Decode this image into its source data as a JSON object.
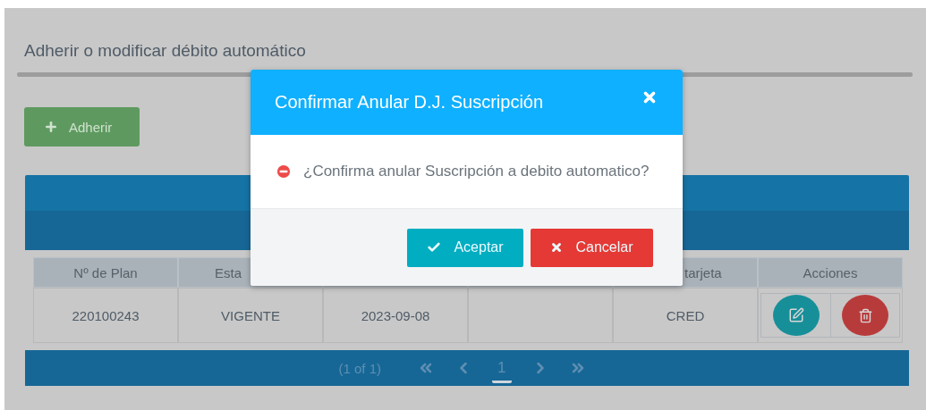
{
  "page": {
    "title": "Adherir o modificar débito automático"
  },
  "add_button": {
    "label": "Adherir"
  },
  "table": {
    "columns": [
      {
        "kind": "text",
        "label": "Nº de Plan"
      },
      {
        "kind": "text",
        "label": "Esta"
      },
      {
        "kind": "covered"
      },
      {
        "kind": "covered"
      },
      {
        "kind": "text",
        "label": "tarjeta"
      },
      {
        "kind": "text",
        "label": "Acciones"
      }
    ],
    "rows": [
      {
        "cells": [
          {
            "kind": "text",
            "text": "220100243"
          },
          {
            "kind": "text",
            "text": "VIGENTE"
          },
          {
            "kind": "text",
            "text": "2023-09-08"
          },
          {
            "kind": "empty"
          },
          {
            "kind": "text",
            "text": "CRED"
          },
          {
            "kind": "actions"
          }
        ]
      }
    ],
    "pagination": {
      "summary": "(1 of 1)",
      "pages": [
        {
          "label": "1",
          "selected": true
        }
      ]
    }
  },
  "dialog": {
    "title": "Confirmar Anular D.J. Suscripción",
    "message": "¿Confirma anular Suscripción a debito automatico?",
    "buttons": [
      {
        "kind": "confirm",
        "label": "Aceptar"
      },
      {
        "kind": "cancel",
        "label": "Cancelar"
      }
    ]
  }
}
